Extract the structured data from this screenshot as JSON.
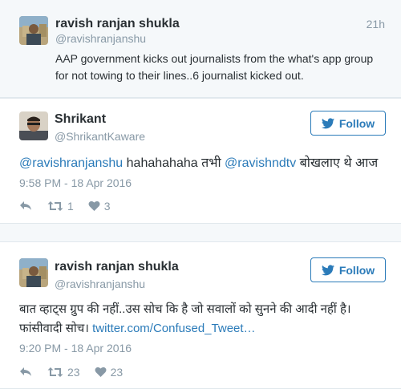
{
  "quoted_tweet": {
    "name": "ravish ranjan shukla",
    "handle": "@ravishranjanshu",
    "time_ago": "21h",
    "text": "AAP government kicks out journalists from the what's app group for not towing to their lines..6 journalist kicked out."
  },
  "tweets": [
    {
      "name": "Shrikant",
      "handle": "@ShrikantKaware",
      "follow_label": "Follow",
      "mention_1": "@ravishranjanshu",
      "text_mid": " hahahahaha तभी ",
      "mention_2": "@ravishndtv",
      "text_end": " बोखलाए थे आज",
      "timestamp": "9:58 PM - 18 Apr 2016",
      "retweets": "1",
      "likes": "3"
    },
    {
      "name": "ravish ranjan shukla",
      "handle": "@ravishranjanshu",
      "follow_label": "Follow",
      "text_line1": "बात व्हाट्स ग्रुप की नहीं..उस सोच कि है जो सवालों को सुनने की आदी नहीं है।",
      "text_line2": "फांसीवादी सोच। ",
      "link": "twitter.com/Confused_Tweet…",
      "timestamp": "9:20 PM - 18 Apr 2016",
      "retweets": "23",
      "likes": "23"
    }
  ],
  "colors": {
    "link": "#2b7bb9",
    "muted": "#8899a6",
    "text": "#292f33",
    "background_gray": "#f5f8fa"
  },
  "icons": {
    "reply": "reply-icon",
    "retweet": "retweet-icon",
    "like": "heart-icon",
    "bird": "twitter-bird-icon"
  }
}
